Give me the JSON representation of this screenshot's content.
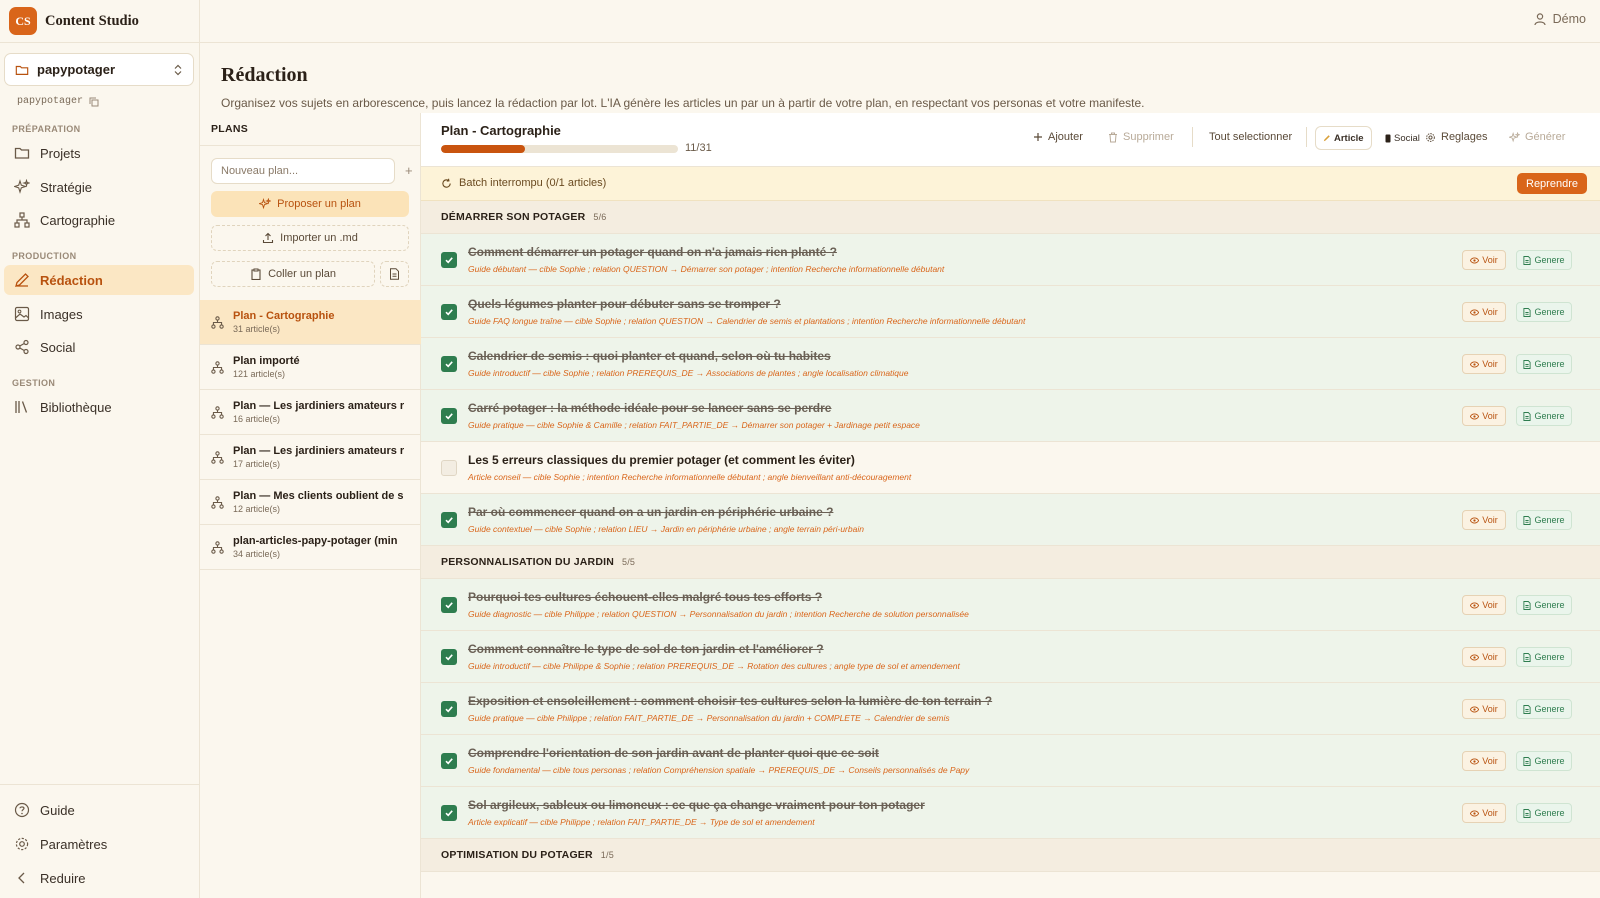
{
  "brand": {
    "logo": "CS",
    "name": "Content Studio"
  },
  "project": {
    "name": "papypotager",
    "slug": "papypotager"
  },
  "sidebar": {
    "sections": [
      {
        "label": "PRÉPARATION"
      },
      {
        "label": "PRODUCTION"
      },
      {
        "label": "GESTION"
      }
    ],
    "items": [
      {
        "label": "Projets",
        "icon": "folder-icon"
      },
      {
        "label": "Stratégie",
        "icon": "sparkles-icon"
      },
      {
        "label": "Cartographie",
        "icon": "sitemap-icon"
      },
      {
        "label": "Rédaction",
        "icon": "pen-icon"
      },
      {
        "label": "Images",
        "icon": "image-icon"
      },
      {
        "label": "Social",
        "icon": "share-icon"
      },
      {
        "label": "Bibliothèque",
        "icon": "library-icon"
      }
    ],
    "bottom": [
      {
        "label": "Guide",
        "icon": "help-icon"
      },
      {
        "label": "Paramètres",
        "icon": "gear-icon"
      },
      {
        "label": "Reduire",
        "icon": "chevron-left-icon"
      }
    ]
  },
  "user": {
    "name": "Démo"
  },
  "page": {
    "title": "Rédaction",
    "subtitle": "Organisez vos sujets en arborescence, puis lancez la rédaction par lot. L'IA génère les articles un par un à partir de votre plan, en respectant vos personas et votre manifeste."
  },
  "plans": {
    "header": "PLANS",
    "new_placeholder": "Nouveau plan...",
    "propose_label": "Proposer un plan",
    "import_label": "Importer un .md",
    "paste_label": "Coller un plan",
    "items": [
      {
        "name": "Plan - Cartographie",
        "count": "31 article(s)"
      },
      {
        "name": "Plan importé",
        "count": "121 article(s)"
      },
      {
        "name": "Plan — Les jardiniers amateurs r",
        "count": "16 article(s)"
      },
      {
        "name": "Plan — Les jardiniers amateurs r",
        "count": "17 article(s)"
      },
      {
        "name": "Plan — Mes clients oublient de s",
        "count": "12 article(s)"
      },
      {
        "name": "plan-articles-papy-potager (min",
        "count": "34 article(s)"
      }
    ]
  },
  "main": {
    "title": "Plan - Cartographie",
    "progress": {
      "done": 11,
      "total": 31,
      "label": "11/31"
    },
    "toolbar": {
      "add": "Ajouter",
      "delete": "Supprimer",
      "select_all": "Tout selectionner",
      "article": "Article",
      "social": "Social",
      "settings": "Reglages",
      "generate": "Générer"
    },
    "batch": {
      "text": "Batch interrompu (0/1 articles)",
      "resume": "Reprendre"
    },
    "actions": {
      "voir": "Voir",
      "genere": "Genere"
    },
    "groups": [
      {
        "title": "DÉMARRER SON POTAGER",
        "count": "5/6",
        "rows": [
          {
            "title": "Comment démarrer un potager quand on n'a jamais rien planté ?",
            "meta": "Guide débutant — cible Sophie ; relation QUESTION → Démarrer son potager ; intention Recherche informationnelle débutant",
            "done": true
          },
          {
            "title": "Quels légumes planter pour débuter sans se tromper ?",
            "meta": "Guide FAQ longue traîne — cible Sophie ; relation QUESTION → Calendrier de semis et plantations ; intention Recherche informationnelle débutant",
            "done": true
          },
          {
            "title": "Calendrier de semis : quoi planter et quand, selon où tu habites",
            "meta": "Guide introductif — cible Sophie ; relation PREREQUIS_DE → Associations de plantes ; angle localisation climatique",
            "done": true
          },
          {
            "title": "Carré potager : la méthode idéale pour se lancer sans se perdre",
            "meta": "Guide pratique — cible Sophie & Camille ; relation FAIT_PARTIE_DE → Démarrer son potager + Jardinage petit espace",
            "done": true
          },
          {
            "title": "Les 5 erreurs classiques du premier potager (et comment les éviter)",
            "meta": "Article conseil — cible Sophie ; intention Recherche informationnelle débutant ; angle bienveillant anti-découragement",
            "done": false
          },
          {
            "title": "Par où commencer quand on a un jardin en périphérie urbaine ?",
            "meta": "Guide contextuel — cible Sophie ; relation LIEU → Jardin en périphérie urbaine ; angle terrain péri-urbain",
            "done": true
          }
        ]
      },
      {
        "title": "PERSONNALISATION DU JARDIN",
        "count": "5/5",
        "rows": [
          {
            "title": "Pourquoi tes cultures échouent-elles malgré tous tes efforts ?",
            "meta": "Guide diagnostic — cible Philippe ; relation QUESTION → Personnalisation du jardin ; intention Recherche de solution personnalisée",
            "done": true
          },
          {
            "title": "Comment connaître le type de sol de ton jardin et l'améliorer ?",
            "meta": "Guide introductif — cible Philippe & Sophie ; relation PREREQUIS_DE → Rotation des cultures ; angle type de sol et amendement",
            "done": true
          },
          {
            "title": "Exposition et ensoleillement : comment choisir tes cultures selon la lumière de ton terrain ?",
            "meta": "Guide pratique — cible Philippe ; relation FAIT_PARTIE_DE → Personnalisation du jardin + COMPLETE → Calendrier de semis",
            "done": true
          },
          {
            "title": "Comprendre l'orientation de son jardin avant de planter quoi que ce soit",
            "meta": "Guide fondamental — cible tous personas ; relation Compréhension spatiale → PREREQUIS_DE → Conseils personnalisés de Papy",
            "done": true
          },
          {
            "title": "Sol argileux, sableux ou limoneux : ce que ça change vraiment pour ton potager",
            "meta": "Article explicatif — cible Philippe ; relation FAIT_PARTIE_DE → Type de sol et amendement",
            "done": true
          }
        ]
      },
      {
        "title": "OPTIMISATION DU POTAGER",
        "count": "1/5",
        "rows": []
      }
    ]
  },
  "colors": {
    "accent": "#d9651a",
    "success": "#2e7d4f",
    "active_bg": "#fbe7c4"
  }
}
